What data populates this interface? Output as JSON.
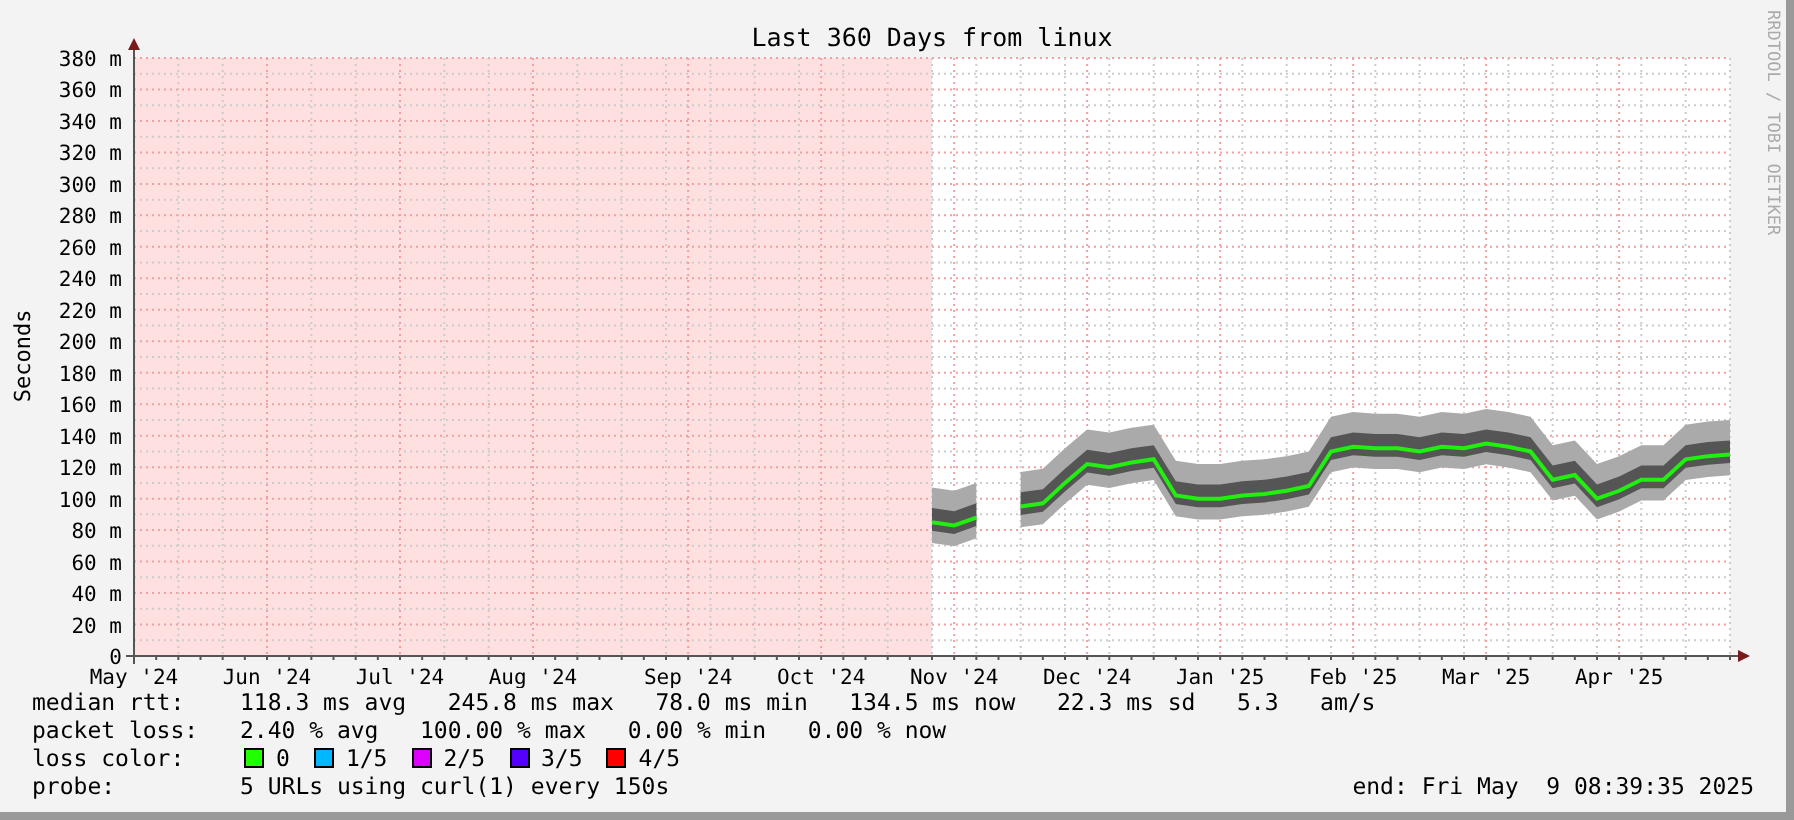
{
  "chart_data": {
    "type": "line",
    "title": "Last 360 Days from linux",
    "ylabel": "Seconds",
    "categories": [
      "May '24",
      null,
      null,
      null,
      null,
      null,
      "Jun '24",
      null,
      null,
      null,
      null,
      null,
      "Jul '24",
      null,
      null,
      null,
      null,
      null,
      "Aug '24",
      null,
      null,
      null,
      null,
      null,
      null,
      "Sep '24",
      null,
      null,
      null,
      null,
      null,
      "Oct '24",
      null,
      null,
      null,
      null,
      null,
      "Nov '24",
      null,
      null,
      null,
      null,
      null,
      "Dec '24",
      null,
      null,
      null,
      null,
      null,
      "Jan '25",
      null,
      null,
      null,
      null,
      null,
      "Feb '25",
      null,
      null,
      null,
      null,
      null,
      "Mar '25",
      null,
      null,
      null,
      null,
      null,
      "Apr '25",
      null,
      null,
      null,
      null,
      null
    ],
    "yticks": [
      {
        "value": 0,
        "label": "0"
      },
      {
        "value": 20,
        "label": "20 m"
      },
      {
        "value": 40,
        "label": "40 m"
      },
      {
        "value": 60,
        "label": "60 m"
      },
      {
        "value": 80,
        "label": "80 m"
      },
      {
        "value": 100,
        "label": "100 m"
      },
      {
        "value": 120,
        "label": "120 m"
      },
      {
        "value": 140,
        "label": "140 m"
      },
      {
        "value": 160,
        "label": "160 m"
      },
      {
        "value": 180,
        "label": "180 m"
      },
      {
        "value": 200,
        "label": "200 m"
      },
      {
        "value": 220,
        "label": "220 m"
      },
      {
        "value": 240,
        "label": "240 m"
      },
      {
        "value": 260,
        "label": "260 m"
      },
      {
        "value": 280,
        "label": "280 m"
      },
      {
        "value": 300,
        "label": "300 m"
      },
      {
        "value": 320,
        "label": "320 m"
      },
      {
        "value": 340,
        "label": "340 m"
      },
      {
        "value": 360,
        "label": "360 m"
      },
      {
        "value": 380,
        "label": "380 m"
      }
    ],
    "ylim": [
      0,
      380
    ],
    "grid": true,
    "series": [
      {
        "color": "#22ee11",
        "values": [
          null,
          null,
          null,
          null,
          null,
          null,
          null,
          null,
          null,
          null,
          null,
          null,
          null,
          null,
          null,
          null,
          null,
          null,
          null,
          null,
          null,
          null,
          null,
          null,
          null,
          null,
          null,
          null,
          null,
          null,
          null,
          null,
          null,
          null,
          null,
          null,
          85,
          83,
          88,
          null,
          95,
          97,
          110,
          122,
          120,
          123,
          125,
          102,
          100,
          100,
          102,
          103,
          105,
          108,
          130,
          133,
          132,
          132,
          130,
          133,
          132,
          135,
          133,
          130,
          112,
          115,
          100,
          105,
          112,
          112,
          125,
          127,
          128
        ]
      }
    ]
  },
  "watermark_side": "RRDTOOL / TOBI OETIKER",
  "legend": [
    {
      "kind": "text",
      "label": "median rtt:",
      "text": "118.3 ms avg   245.8 ms max   78.0 ms min   134.5 ms now   22.3 ms sd   5.3   am/s"
    },
    {
      "kind": "text",
      "label": "packet loss:",
      "text": "2.40 % avg   100.00 % max   0.00 % min   0.00 % now"
    },
    {
      "kind": "colors",
      "label": "loss color:",
      "items": [
        {
          "label": "0",
          "color": "#22ff00"
        },
        {
          "label": "1/5",
          "color": "#00b8ff"
        },
        {
          "label": "2/5",
          "color": "#dd00ff"
        },
        {
          "label": "3/5",
          "color": "#5500ff"
        },
        {
          "label": "4/5",
          "color": "#ff0000"
        }
      ]
    },
    {
      "kind": "text",
      "label": "probe:",
      "text": "5 URLs using curl(1) every 150s"
    }
  ],
  "end": "end: Fri May  9 08:39:35 2025"
}
